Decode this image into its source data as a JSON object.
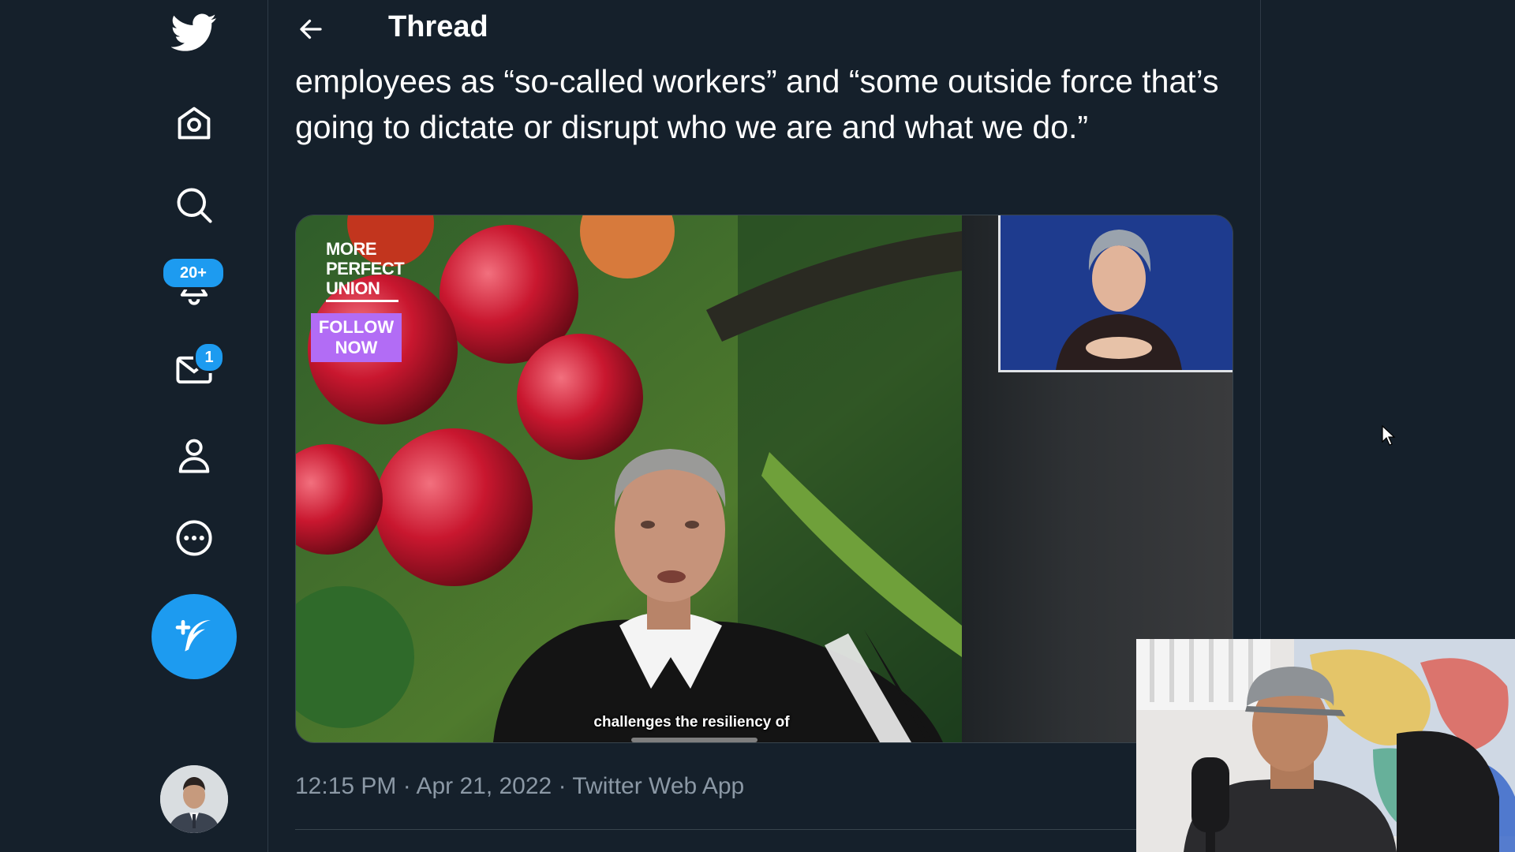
{
  "sidebar": {
    "logo_icon": "twitter-bird-icon",
    "items": [
      {
        "name": "home",
        "icon": "home-icon"
      },
      {
        "name": "explore",
        "icon": "search-icon"
      },
      {
        "name": "notifications",
        "icon": "bell-icon",
        "badge": "20+"
      },
      {
        "name": "messages",
        "icon": "mail-icon",
        "badge": "1"
      },
      {
        "name": "profile",
        "icon": "person-icon"
      },
      {
        "name": "more",
        "icon": "more-circle-icon"
      }
    ],
    "compose_icon": "compose-tweet-icon",
    "accent_color": "#1d9bf0"
  },
  "header": {
    "back_icon": "back-arrow-icon",
    "title": "Thread"
  },
  "tweet": {
    "text": "employees as “so-called workers” and “some outside force that’s going to dictate or disrupt who we are and what we do.”",
    "media": {
      "overlay_logo": "MORE PERFECT UNION",
      "overlay_button": "FOLLOW NOW",
      "caption": "challenges the resiliency of"
    },
    "time": "12:15 PM",
    "separator": " · ",
    "date": "Apr 21, 2022",
    "source": "Twitter Web App"
  },
  "colors": {
    "background": "#15202b",
    "secondary_text": "#8b98a5",
    "border": "#38444d",
    "follow_button": "#b26cf5"
  }
}
